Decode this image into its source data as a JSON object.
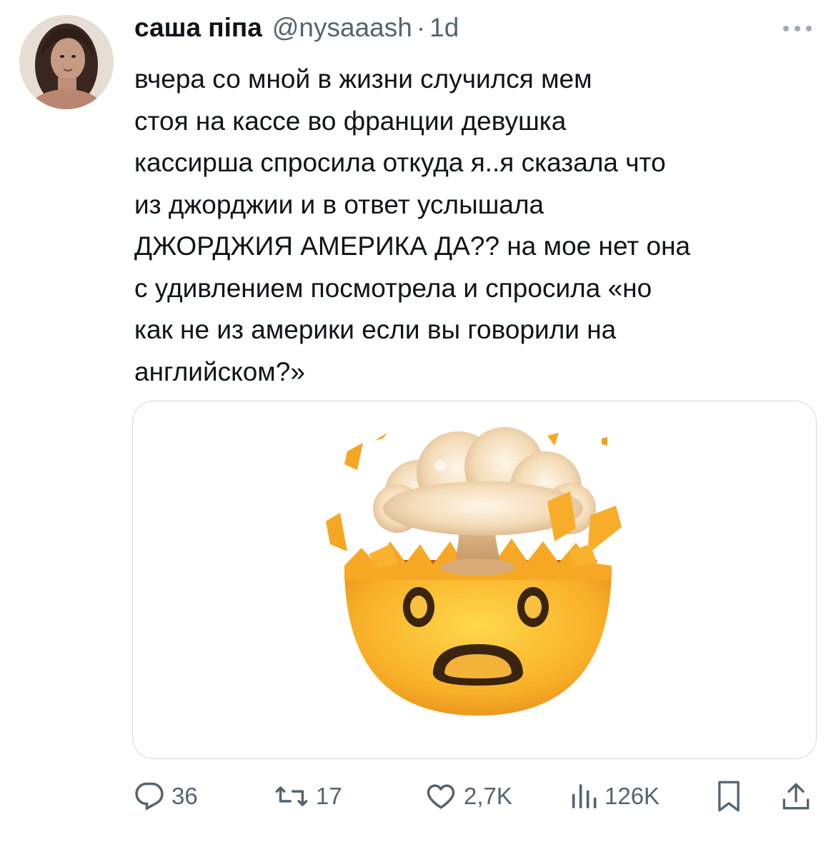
{
  "tweet": {
    "author_name": "саша піпа",
    "handle": "@nysaaash",
    "separator": "·",
    "time": "1d",
    "text_lines": [
      "вчера со мной в жизни случился мем",
      "стоя на кассе во франции девушка",
      "кассирша спросила откуда я..я сказала что",
      "из джорджии и в ответ услышала",
      "ДЖОРДЖИЯ АМЕРИКА ДА?? на мое нет она",
      "с удивлением посмотрела и спросила «но",
      "как не из америки если вы говорили на",
      "английском?»"
    ]
  },
  "media": {
    "emoji_name": "exploding-head-emoji"
  },
  "actions": {
    "reply_count": "36",
    "retweet_count": "17",
    "like_count": "2,7K",
    "views_count": "126K"
  },
  "icons": {
    "more": "more-horizontal-icon",
    "reply": "reply-icon",
    "retweet": "retweet-icon",
    "like": "heart-icon",
    "views": "views-icon",
    "bookmark": "bookmark-icon",
    "share": "share-icon"
  },
  "colors": {
    "text": "#0f1419",
    "secondary": "#536471",
    "border": "#cfd9de"
  }
}
